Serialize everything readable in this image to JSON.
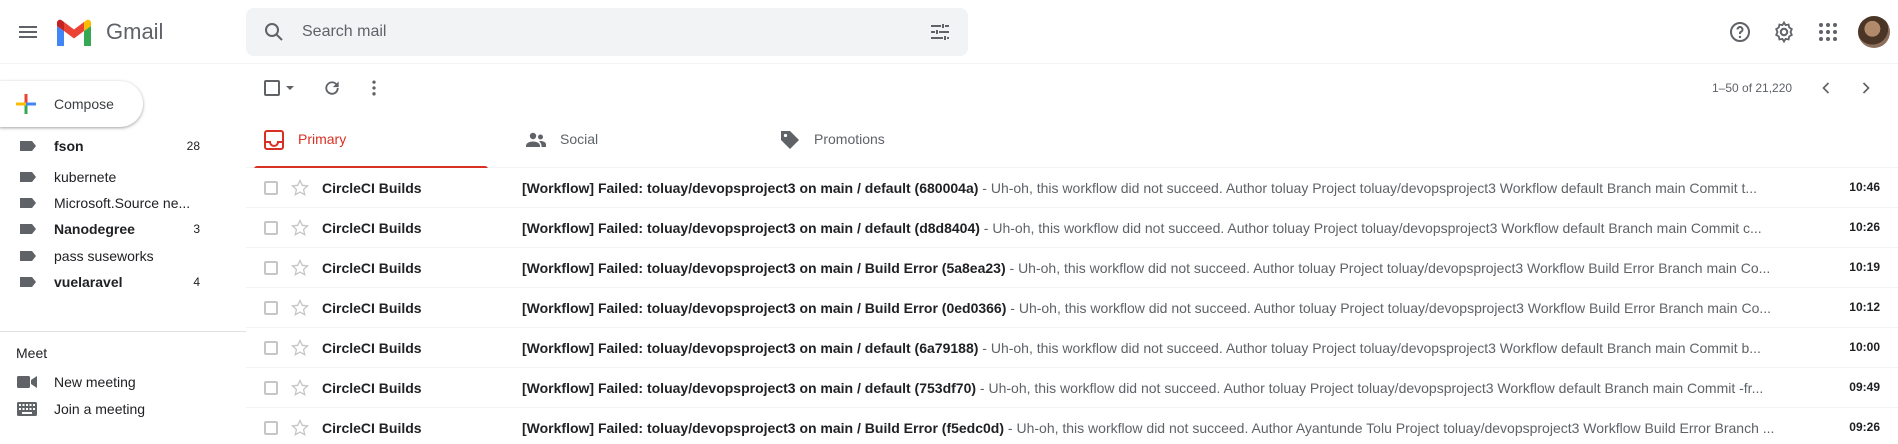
{
  "header": {
    "brand": "Gmail",
    "search_placeholder": "Search mail",
    "icons": [
      "menu-icon",
      "search-icon",
      "tune-icon",
      "help-icon",
      "settings-icon",
      "apps-icon"
    ]
  },
  "sidebar": {
    "compose_label": "Compose",
    "labels": [
      {
        "name": "fson",
        "count": "28",
        "bold": true
      },
      {
        "name": "kubernete",
        "count": "",
        "bold": false
      },
      {
        "name": "Microsoft.Source ne...",
        "count": "",
        "bold": false
      },
      {
        "name": "Nanodegree",
        "count": "3",
        "bold": true
      },
      {
        "name": "pass suseworks",
        "count": "",
        "bold": false
      },
      {
        "name": "vuelaravel",
        "count": "4",
        "bold": true
      }
    ],
    "meet": {
      "title": "Meet",
      "new_meeting": "New meeting",
      "join_meeting": "Join a meeting"
    }
  },
  "toolbar": {
    "paging": "1–50 of 21,220"
  },
  "tabs": [
    {
      "label": "Primary",
      "active": true
    },
    {
      "label": "Social",
      "active": false
    },
    {
      "label": "Promotions",
      "active": false
    }
  ],
  "emails": [
    {
      "sender": "CircleCI Builds",
      "subject": "[Workflow] Failed: toluay/devopsproject3 on main / default (680004a)",
      "snippet": " - Uh-oh, this workflow did not succeed. Author toluay Project toluay/devopsproject3 Workflow default Branch main Commit t...",
      "time": "10:46"
    },
    {
      "sender": "CircleCI Builds",
      "subject": "[Workflow] Failed: toluay/devopsproject3 on main / default (d8d8404)",
      "snippet": " - Uh-oh, this workflow did not succeed. Author toluay Project toluay/devopsproject3 Workflow default Branch main Commit c...",
      "time": "10:26"
    },
    {
      "sender": "CircleCI Builds",
      "subject": "[Workflow] Failed: toluay/devopsproject3 on main / Build Error (5a8ea23)",
      "snippet": " - Uh-oh, this workflow did not succeed. Author toluay Project toluay/devopsproject3 Workflow Build Error Branch main Co...",
      "time": "10:19"
    },
    {
      "sender": "CircleCI Builds",
      "subject": "[Workflow] Failed: toluay/devopsproject3 on main / Build Error (0ed0366)",
      "snippet": " - Uh-oh, this workflow did not succeed. Author toluay Project toluay/devopsproject3 Workflow Build Error Branch main Co...",
      "time": "10:12"
    },
    {
      "sender": "CircleCI Builds",
      "subject": "[Workflow] Failed: toluay/devopsproject3 on main / default (6a79188)",
      "snippet": " - Uh-oh, this workflow did not succeed. Author toluay Project toluay/devopsproject3 Workflow default Branch main Commit b...",
      "time": "10:00"
    },
    {
      "sender": "CircleCI Builds",
      "subject": "[Workflow] Failed: toluay/devopsproject3 on main / default (753df70)",
      "snippet": " - Uh-oh, this workflow did not succeed. Author toluay Project toluay/devopsproject3 Workflow default Branch main Commit -fr...",
      "time": "09:49"
    },
    {
      "sender": "CircleCI Builds",
      "subject": "[Workflow] Failed: toluay/devopsproject3 on main / Build Error (f5edc0d)",
      "snippet": " - Uh-oh, this workflow did not succeed. Author Ayantunde Tolu Project toluay/devopsproject3 Workflow Build Error Branch ...",
      "time": "09:26"
    }
  ],
  "colors": {
    "accent_red": "#d93025",
    "search_bg": "#f1f3f4",
    "muted_text": "#5f6368"
  }
}
